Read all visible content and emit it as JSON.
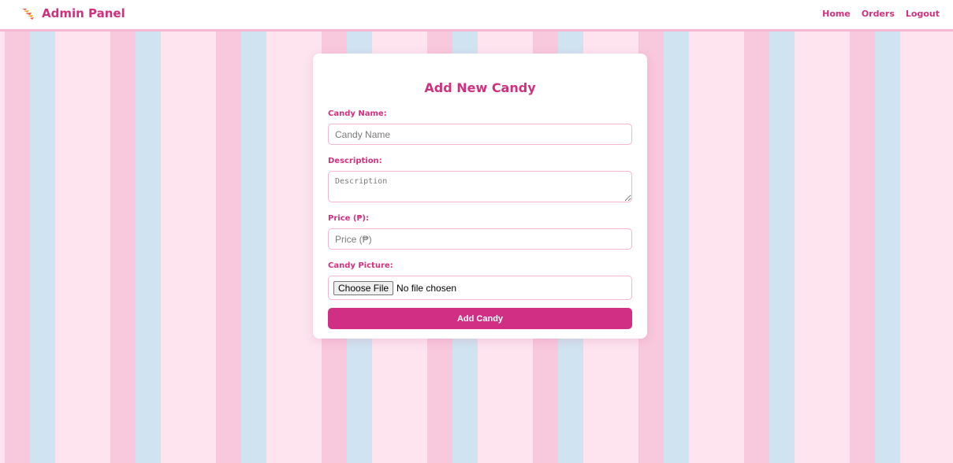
{
  "navbar": {
    "brand_icon": "candy-icon",
    "brand_title": "Admin Panel",
    "links": [
      {
        "label": "Home"
      },
      {
        "label": "Orders"
      },
      {
        "label": "Logout"
      }
    ]
  },
  "form": {
    "title": "Add New Candy",
    "name_label": "Candy Name:",
    "name_placeholder": "Candy Name",
    "description_label": "Description:",
    "description_placeholder": "Description",
    "price_label": "Price (₱):",
    "price_placeholder": "Price (₱)",
    "picture_label": "Candy Picture:",
    "file_button_label": "Choose File",
    "file_status": "No file chosen",
    "submit_label": "Add Candy"
  },
  "colors": {
    "accent": "#d0307f",
    "button": "#d12f83",
    "stripe_pink": "#f8c8dc",
    "stripe_blue": "#cfe4f0",
    "background": "#fde4ef"
  }
}
